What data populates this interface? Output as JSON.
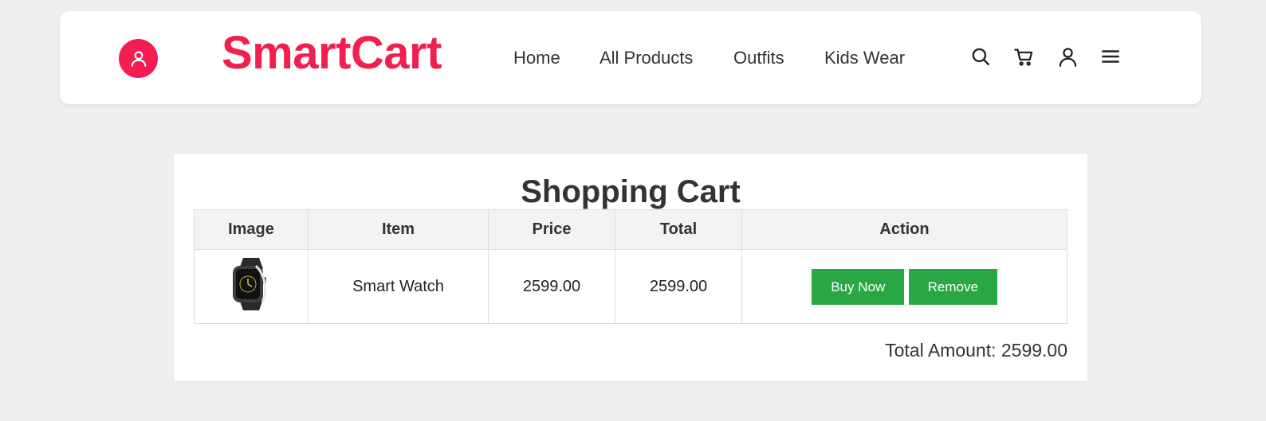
{
  "header": {
    "brand": "SmartCart",
    "nav": [
      "Home",
      "All Products",
      "Outfits",
      "Kids Wear"
    ],
    "icons": [
      "search-icon",
      "cart-icon",
      "user-icon",
      "menu-icon"
    ],
    "accent_color": "#f01f50"
  },
  "cart": {
    "title": "Shopping Cart",
    "columns": [
      "Image",
      "Item",
      "Price",
      "Total",
      "Action"
    ],
    "rows": [
      {
        "image": "smart-watch-image",
        "item": "Smart Watch",
        "price": "2599.00",
        "total": "2599.00",
        "buy_label": "Buy Now",
        "remove_label": "Remove"
      }
    ],
    "total_label": "Total Amount: 2599.00",
    "button_color": "#29a744"
  }
}
